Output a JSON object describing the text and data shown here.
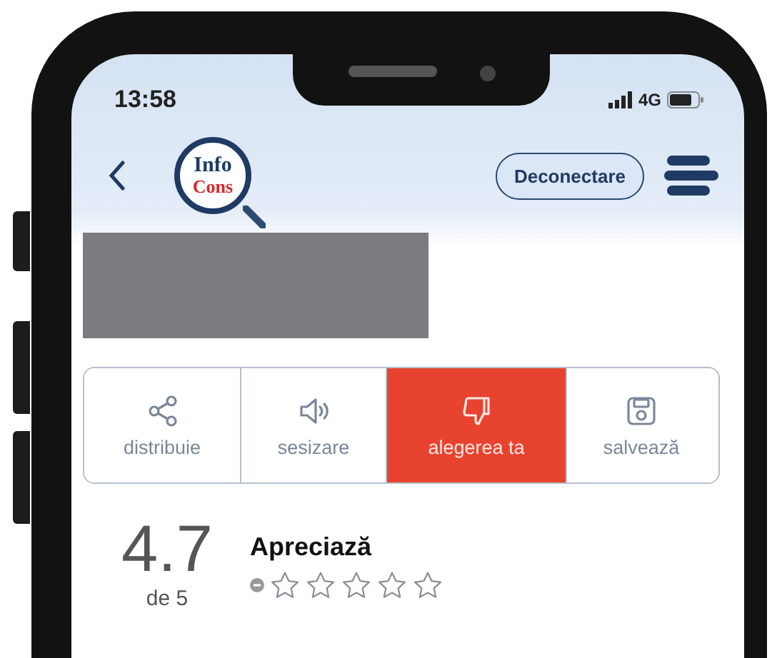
{
  "status_bar": {
    "time": "13:58",
    "network": "4G"
  },
  "header": {
    "logo": {
      "line1": "Info",
      "line2": "Cons"
    },
    "logout_button": "Deconectare"
  },
  "actions": [
    {
      "kind": "share",
      "label": "distribuie",
      "selected": false
    },
    {
      "kind": "speaker",
      "label": "sesizare",
      "selected": false
    },
    {
      "kind": "thumbs-down",
      "label": "alegerea ta",
      "selected": true
    },
    {
      "kind": "save",
      "label": "salvează",
      "selected": false
    }
  ],
  "rating": {
    "score": "4.7",
    "out_of": "de 5",
    "title": "Apreciază",
    "stars": 0
  }
}
